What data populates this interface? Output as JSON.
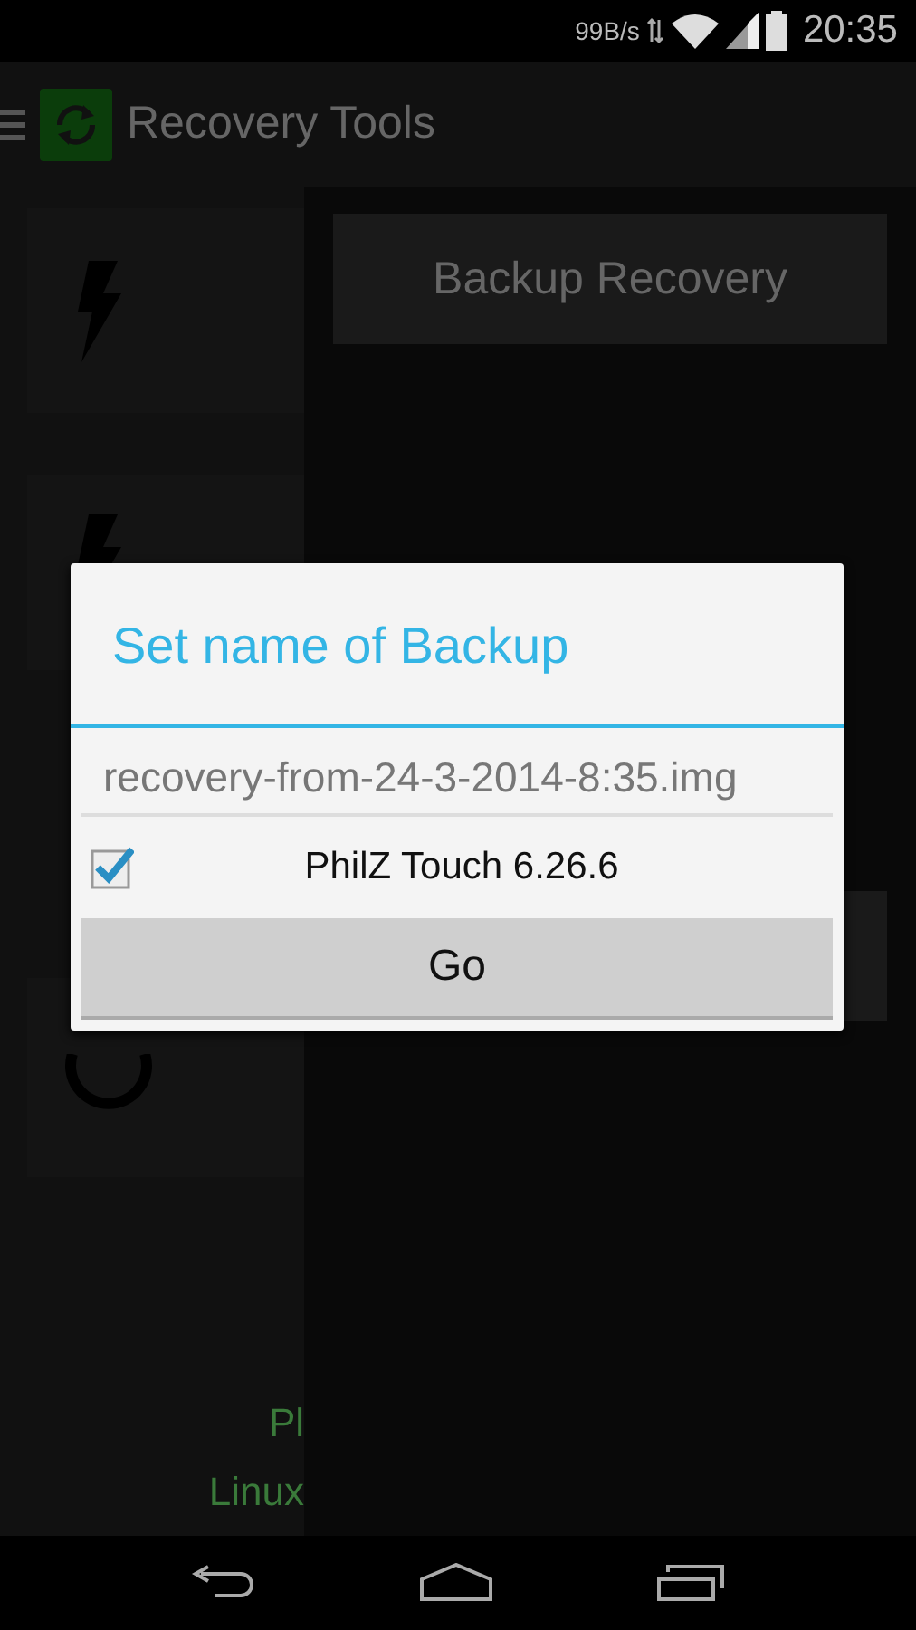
{
  "status_bar": {
    "network_speed": "99B/s",
    "time": "20:35"
  },
  "action_bar": {
    "title": "Recovery Tools"
  },
  "sidebar": {
    "footer_texts": [
      "Pl",
      "Linux"
    ]
  },
  "main": {
    "button": "Backup Recovery"
  },
  "dialog": {
    "title": "Set name of Backup",
    "filename_field": {
      "value": "recovery-from-24-3-2014-8:35.img"
    },
    "option": {
      "label": "PhilZ Touch 6.26.6",
      "checked": true
    },
    "button": "Go"
  }
}
